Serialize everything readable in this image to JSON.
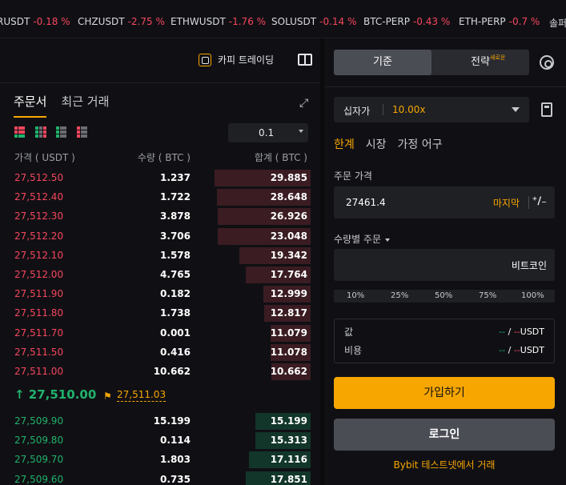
{
  "ticker": [
    {
      "symbol": "RUSDT",
      "change": "-0.18 %"
    },
    {
      "symbol": "CHZUSDT",
      "change": "-2.75 %"
    },
    {
      "symbol": "ETHWUSDT",
      "change": "-1.76 %"
    },
    {
      "symbol": "SOLUSDT",
      "change": "-0.14 %"
    },
    {
      "symbol": "BTC-PERP",
      "change": "-0.43 %"
    },
    {
      "symbol": "ETH-PERP",
      "change": "-0.7 %"
    },
    {
      "symbol": "솔퍼",
      "change": ""
    }
  ],
  "toolbar": {
    "copy_trading_label": "카피 트레이딩"
  },
  "orderbook": {
    "tabs": [
      {
        "label": "주문서",
        "active": true
      },
      {
        "label": "최근 거래",
        "active": false
      }
    ],
    "tick_size": "0.1",
    "headers": {
      "price": "가격 ( USDT )",
      "qty": "수량 ( BTC )",
      "total": "합계 ( BTC )"
    },
    "asks": [
      {
        "price": "27,512.50",
        "qty": "1.237",
        "total": "29.885",
        "depth": 0.89
      },
      {
        "price": "27,512.40",
        "qty": "1.722",
        "total": "28.648",
        "depth": 0.87
      },
      {
        "price": "27,512.30",
        "qty": "3.878",
        "total": "26.926",
        "depth": 0.86
      },
      {
        "price": "27,512.20",
        "qty": "3.706",
        "total": "23.048",
        "depth": 0.86
      },
      {
        "price": "27,512.10",
        "qty": "1.578",
        "total": "19.342",
        "depth": 0.66
      },
      {
        "price": "27,512.00",
        "qty": "4.765",
        "total": "17.764",
        "depth": 0.6
      },
      {
        "price": "27,511.90",
        "qty": "0.182",
        "total": "12.999",
        "depth": 0.44
      },
      {
        "price": "27,511.80",
        "qty": "1.738",
        "total": "12.817",
        "depth": 0.43
      },
      {
        "price": "27,511.70",
        "qty": "0.001",
        "total": "11.079",
        "depth": 0.37
      },
      {
        "price": "27,511.50",
        "qty": "0.416",
        "total": "11.078",
        "depth": 0.37
      },
      {
        "price": "27,511.00",
        "qty": "10.662",
        "total": "10.662",
        "depth": 0.36
      }
    ],
    "last_price": "27,510.00",
    "mark_price": "27,511.03",
    "bids": [
      {
        "price": "27,509.90",
        "qty": "15.199",
        "total": "15.199",
        "depth": 0.51
      },
      {
        "price": "27,509.80",
        "qty": "0.114",
        "total": "15.313",
        "depth": 0.51
      },
      {
        "price": "27,509.70",
        "qty": "1.803",
        "total": "17.116",
        "depth": 0.57
      },
      {
        "price": "27,509.60",
        "qty": "0.735",
        "total": "17.851",
        "depth": 0.6
      }
    ]
  },
  "order_panel": {
    "segment": {
      "basic": "기준",
      "advanced": "전략",
      "badge": "새로운"
    },
    "margin_mode": "십자가",
    "leverage": "10.00x",
    "order_types": [
      "한계",
      "시장",
      "가정 어구"
    ],
    "price_label": "주문 가격",
    "price_value": "27461.4",
    "last_label": "마지막",
    "qty_label": "수량별 주문",
    "qty_unit": "비트코인",
    "percentages": [
      "10%",
      "25%",
      "50%",
      "75%",
      "100%"
    ],
    "value_label": "값",
    "cost_label": "비용",
    "dash": "--",
    "slash": " / ",
    "unit_usdt": "USDT",
    "signup_label": "가입하기",
    "login_label": "로그인",
    "testnet_label": "Bybit 테스트넷에서 거래"
  },
  "colors": {
    "accent": "#f7a600",
    "sell": "#f6465d",
    "buy": "#20b26c"
  }
}
